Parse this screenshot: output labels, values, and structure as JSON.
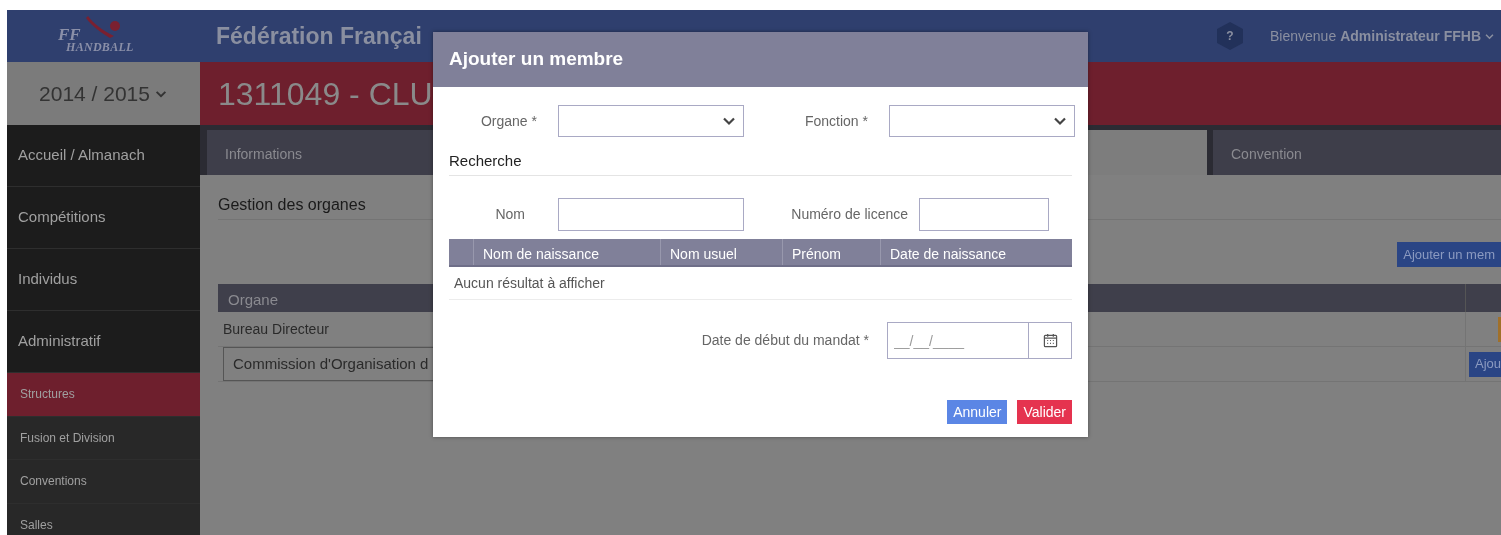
{
  "header": {
    "logo": {
      "line1": "FF",
      "line2": "HANDBALL"
    },
    "title": "Fédération Françai",
    "help": "?",
    "welcome": "Bienvenue",
    "user": "Administrateur FFHB"
  },
  "season": "2014 / 2015",
  "structure_title": "1311049 - CLU",
  "sidebar": [
    {
      "label": "Accueil / Almanach",
      "kind": "main",
      "selected": false
    },
    {
      "label": "Compétitions",
      "kind": "main",
      "selected": false
    },
    {
      "label": "Individus",
      "kind": "main",
      "selected": false
    },
    {
      "label": "Administratif",
      "kind": "main",
      "selected": false
    },
    {
      "label": "Structures",
      "kind": "sub",
      "selected": true
    },
    {
      "label": "Fusion et Division",
      "kind": "sub",
      "selected": false
    },
    {
      "label": "Conventions",
      "kind": "sub",
      "selected": false
    },
    {
      "label": "Salles",
      "kind": "sub",
      "selected": false
    }
  ],
  "tabs": [
    {
      "label": "Informations",
      "selected": false
    },
    {
      "label": "Convention",
      "selected": false
    }
  ],
  "section_title": "Gestion des organes",
  "add_member_button": "Ajouter un mem",
  "table": {
    "columns": [
      "Organe"
    ],
    "rows": [
      {
        "name": "Bureau Directeur",
        "boxed": false
      },
      {
        "name": "Commission d'Organisation d",
        "boxed": true,
        "action": "Ajou"
      }
    ]
  },
  "dialog": {
    "title": "Ajouter un membre",
    "selects": [
      {
        "label": "Organe",
        "mark": "*"
      },
      {
        "label": "Fonction",
        "mark": "*"
      }
    ],
    "search_title": "Recherche",
    "search_fields": [
      {
        "label": "Nom"
      },
      {
        "label": "Numéro de licence"
      }
    ],
    "results": {
      "columns": [
        "Nom de naissance",
        "Nom usuel",
        "Prénom",
        "Date de naissance"
      ],
      "empty": "Aucun résultat à afficher"
    },
    "date": {
      "label": "Date de début du mandat",
      "mark": "*",
      "placeholder": "__/__/____"
    },
    "buttons": [
      {
        "label": "Annuler",
        "kind": "cancel"
      },
      {
        "label": "Valider",
        "kind": "confirm"
      }
    ]
  }
}
